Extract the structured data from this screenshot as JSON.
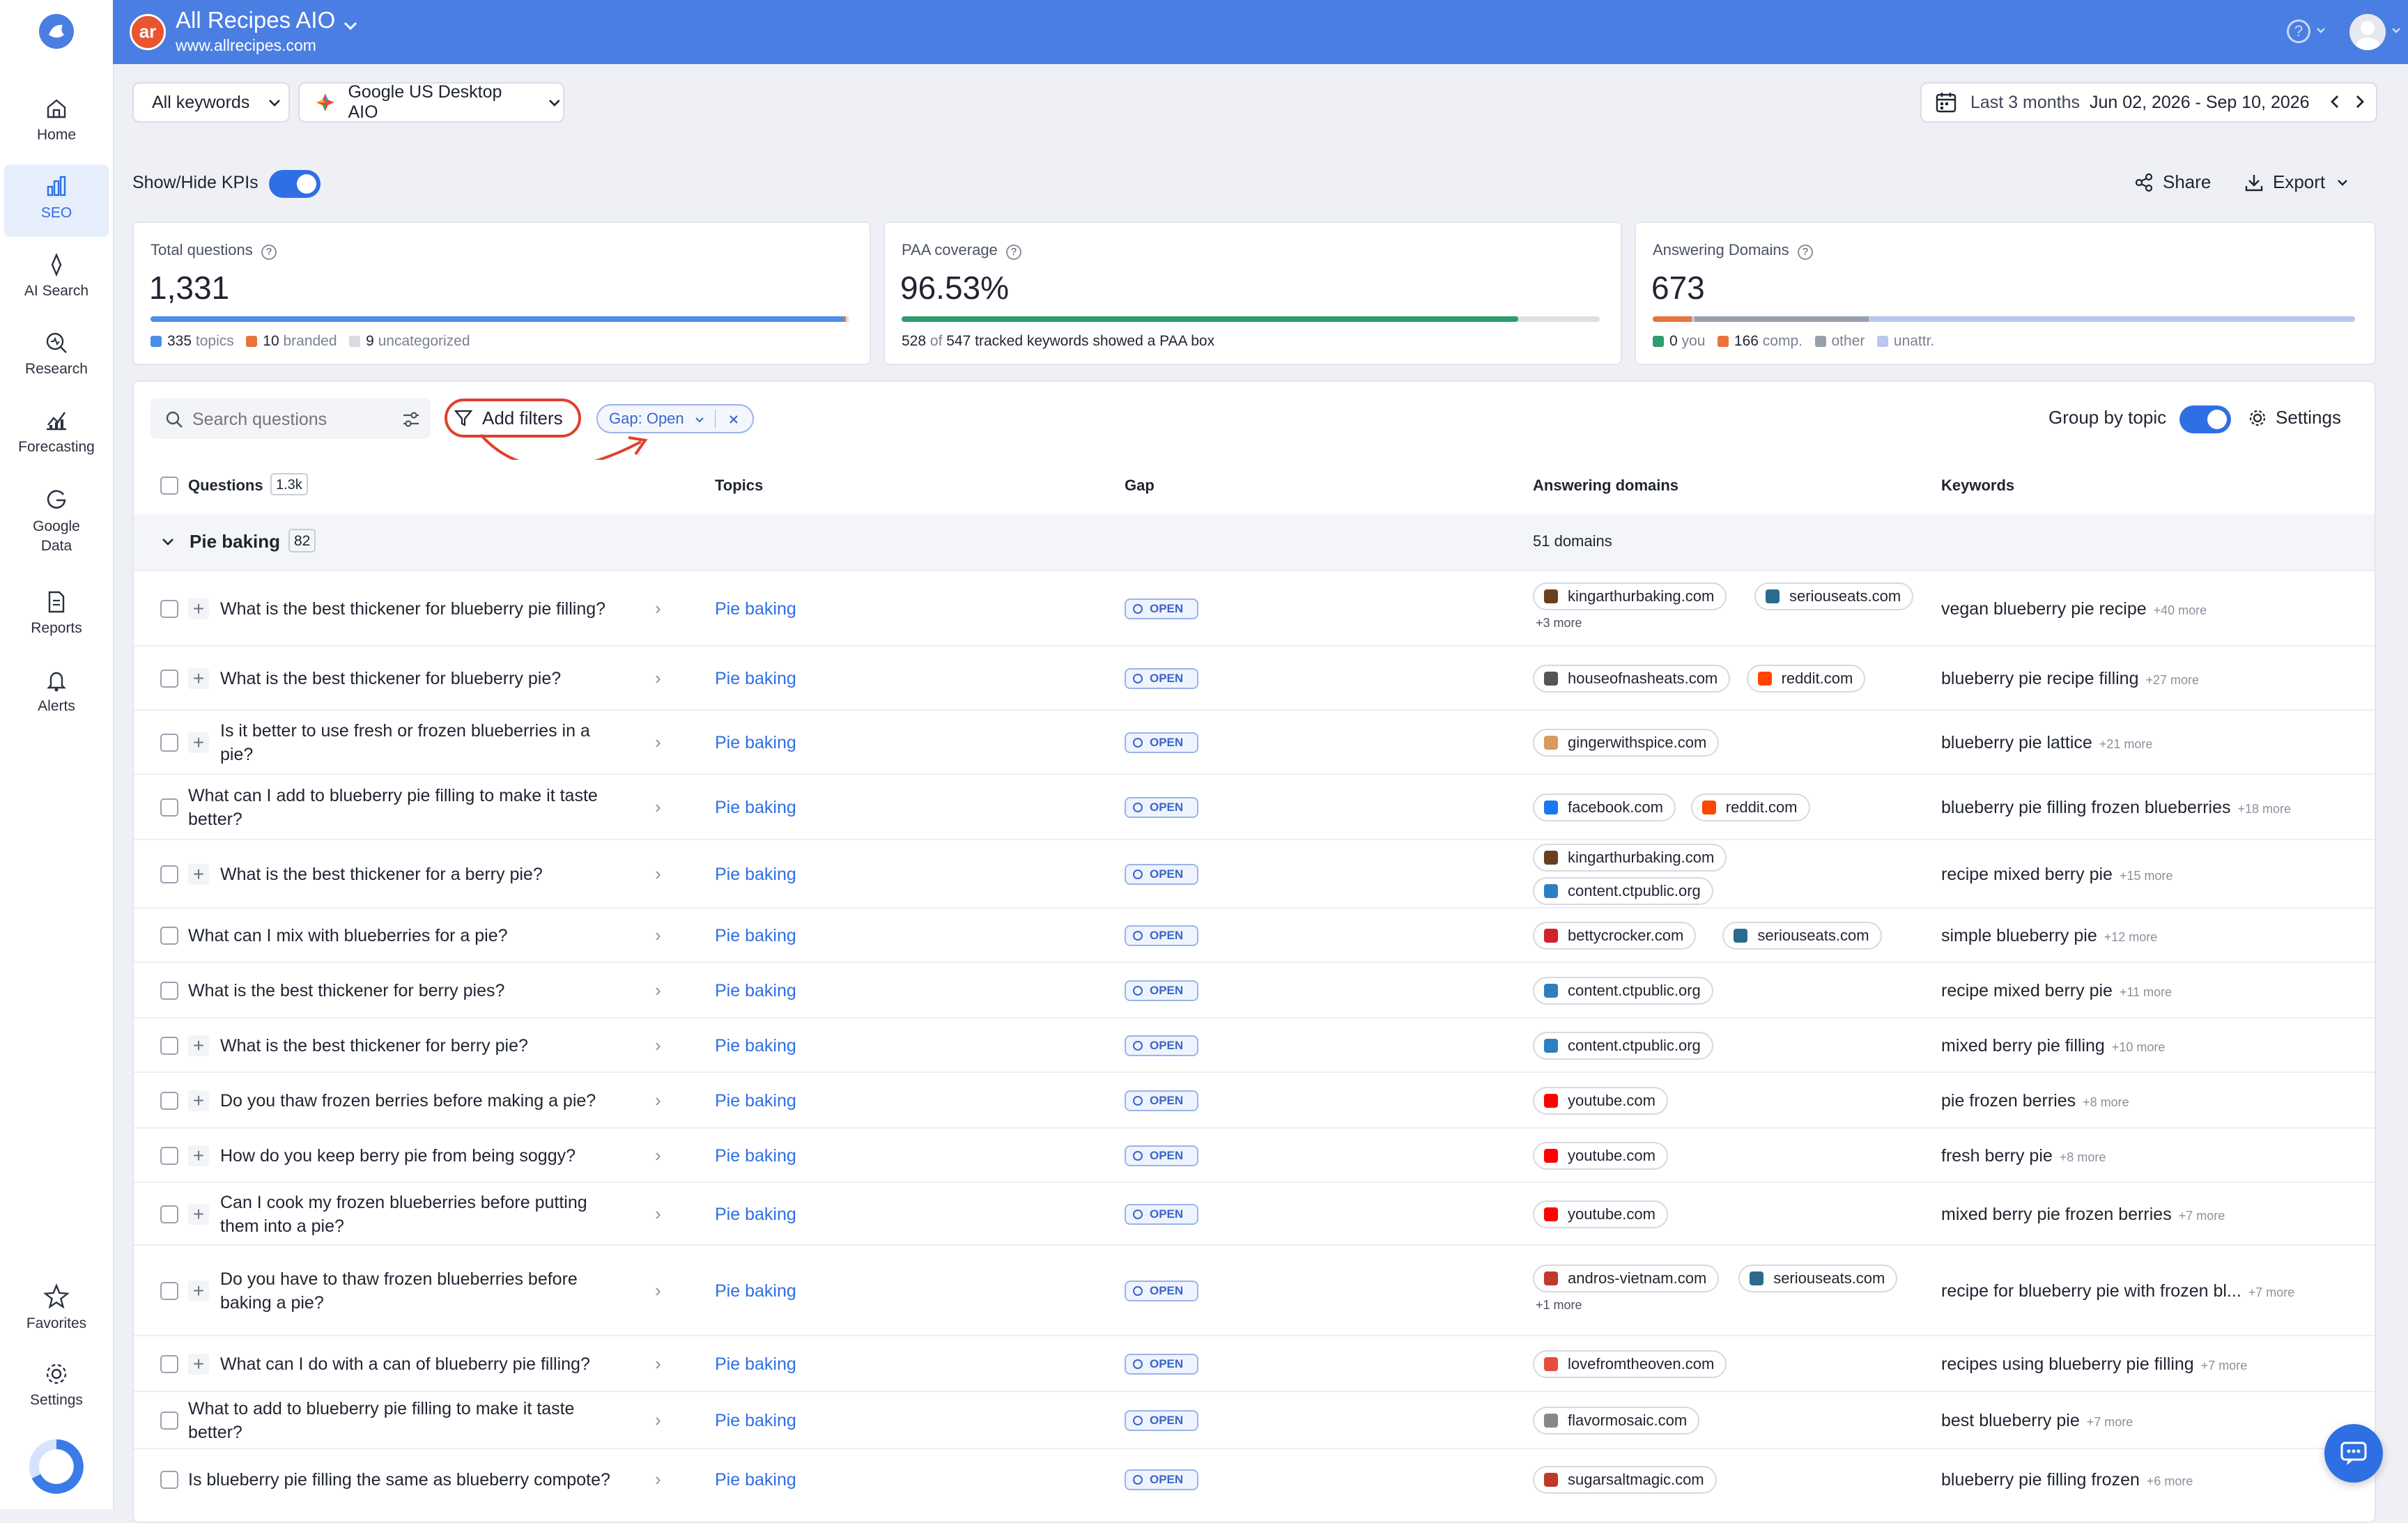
{
  "app": {
    "title": "All Recipes AIO",
    "url": "www.allrecipes.com",
    "logo_text": "ar"
  },
  "nav": [
    {
      "label": "Home",
      "icon": "home-icon"
    },
    {
      "label": "SEO",
      "icon": "bar-chart-icon",
      "active": true
    },
    {
      "label": "AI Search",
      "icon": "sparkle-icon"
    },
    {
      "label": "Research",
      "icon": "magnifier-icon"
    },
    {
      "label": "Forecasting",
      "icon": "chart-line-icon"
    },
    {
      "label": "Google Data",
      "icon": "google-icon"
    },
    {
      "label": "Reports",
      "icon": "report-icon"
    },
    {
      "label": "Alerts",
      "icon": "bell-icon"
    },
    {
      "label": "Favorites",
      "icon": "star-icon"
    },
    {
      "label": "Settings",
      "icon": "gear-icon"
    }
  ],
  "filters": {
    "keywords": "All keywords",
    "engine": "Google US Desktop AIO",
    "period": "Last 3 months",
    "range": "Jun 02, 2026 - Sep 10, 2026"
  },
  "toolbar": {
    "kpi_toggle": "Show/Hide KPIs",
    "share": "Share",
    "export": "Export"
  },
  "kpis": {
    "total": {
      "label": "Total questions",
      "value": "1,331",
      "topics_n": "335",
      "topics": "topics",
      "branded_n": "10",
      "branded": "branded",
      "uncat_n": "9",
      "uncat": "uncategorized"
    },
    "paa": {
      "label": "PAA coverage",
      "value": "96.53%",
      "covered": "528",
      "of": "of",
      "tracked": "547",
      "rest": "tracked keywords showed a PAA box",
      "fill_fraction": 0.9653
    },
    "domains": {
      "label": "Answering Domains",
      "value": "673",
      "you_n": "0",
      "you": "you",
      "comp_n": "166",
      "comp": "comp.",
      "other": "other",
      "unattr": "unattr."
    }
  },
  "table_tools": {
    "search_placeholder": "Search questions",
    "add_filters": "Add filters",
    "filter_chip_key": "Gap:",
    "filter_chip_value": "Open",
    "group_by": "Group by topic",
    "settings": "Settings"
  },
  "columns": {
    "questions": "Questions",
    "questions_count": "1.3k",
    "topics": "Topics",
    "gap": "Gap",
    "domains": "Answering domains",
    "keywords": "Keywords"
  },
  "group": {
    "name": "Pie baking",
    "count": "82",
    "domains": "51 domains"
  },
  "rows": [
    {
      "q": "What is the best thickener for blueberry pie filling?",
      "plus": true,
      "topic": "Pie baking",
      "gap": "OPEN",
      "domains": [
        "kingarthurbaking.com",
        "seriouseats.com"
      ],
      "domains_more": "+3 more",
      "kw": "vegan blueberry pie recipe",
      "kw_more": "+40 more"
    },
    {
      "q": "What is the best thickener for blueberry pie?",
      "plus": true,
      "topic": "Pie baking",
      "gap": "OPEN",
      "domains": [
        "houseofnasheats.com",
        "reddit.com"
      ],
      "domains_more": "",
      "kw": "blueberry pie recipe filling",
      "kw_more": "+27 more"
    },
    {
      "q": "Is it better to use fresh or frozen blueberries in a",
      "q2": "pie?",
      "plus": true,
      "topic": "Pie baking",
      "gap": "OPEN",
      "domains": [
        "gingerwithspice.com"
      ],
      "domains_more": "",
      "kw": "blueberry pie lattice",
      "kw_more": "+21 more"
    },
    {
      "q": "What can I add to blueberry pie filling to make it taste",
      "q2": "better?",
      "plus": false,
      "topic": "Pie baking",
      "gap": "OPEN",
      "domains": [
        "facebook.com",
        "reddit.com"
      ],
      "domains_more": "",
      "kw": "blueberry pie filling frozen blueberries",
      "kw_more": "+18 more"
    },
    {
      "q": "What is the best thickener for a berry pie?",
      "plus": true,
      "topic": "Pie baking",
      "gap": "OPEN",
      "domains": [
        "kingarthurbaking.com",
        "content.ctpublic.org"
      ],
      "domains_more": "",
      "kw": "recipe mixed berry pie",
      "kw_more": "+15 more"
    },
    {
      "q": "What can I mix with blueberries for a pie?",
      "plus": false,
      "topic": "Pie baking",
      "gap": "OPEN",
      "domains": [
        "bettycrocker.com",
        "seriouseats.com"
      ],
      "domains_more": "",
      "kw": "simple blueberry pie",
      "kw_more": "+12 more"
    },
    {
      "q": "What is the best thickener for berry pies?",
      "plus": false,
      "topic": "Pie baking",
      "gap": "OPEN",
      "domains": [
        "content.ctpublic.org"
      ],
      "domains_more": "",
      "kw": "recipe mixed berry pie",
      "kw_more": "+11 more"
    },
    {
      "q": "What is the best thickener for berry pie?",
      "plus": true,
      "topic": "Pie baking",
      "gap": "OPEN",
      "domains": [
        "content.ctpublic.org"
      ],
      "domains_more": "",
      "kw": "mixed berry pie filling",
      "kw_more": "+10 more"
    },
    {
      "q": "Do you thaw frozen berries before making a pie?",
      "plus": true,
      "topic": "Pie baking",
      "gap": "OPEN",
      "domains": [
        "youtube.com"
      ],
      "domains_more": "",
      "kw": "pie frozen berries",
      "kw_more": "+8 more"
    },
    {
      "q": "How do you keep berry pie from being soggy?",
      "plus": true,
      "topic": "Pie baking",
      "gap": "OPEN",
      "domains": [
        "youtube.com"
      ],
      "domains_more": "",
      "kw": "fresh berry pie",
      "kw_more": "+8 more"
    },
    {
      "q": "Can I cook my frozen blueberries before putting",
      "q2": "them into a pie?",
      "plus": true,
      "topic": "Pie baking",
      "gap": "OPEN",
      "domains": [
        "youtube.com"
      ],
      "domains_more": "",
      "kw": "mixed berry pie frozen berries",
      "kw_more": "+7 more"
    },
    {
      "q": "Do you have to thaw frozen blueberries before",
      "q2": "baking a pie?",
      "plus": true,
      "topic": "Pie baking",
      "gap": "OPEN",
      "domains": [
        "andros-vietnam.com",
        "seriouseats.com"
      ],
      "domains_more": "+1 more",
      "kw": "recipe for blueberry pie with frozen bl...",
      "kw_more": "+7 more"
    },
    {
      "q": "What can I do with a can of blueberry pie filling?",
      "plus": true,
      "topic": "Pie baking",
      "gap": "OPEN",
      "domains": [
        "lovefromtheoven.com"
      ],
      "domains_more": "",
      "kw": "recipes using blueberry pie filling",
      "kw_more": "+7 more"
    },
    {
      "q": "What to add to blueberry pie filling to make it taste",
      "q2": "better?",
      "plus": false,
      "topic": "Pie baking",
      "gap": "OPEN",
      "domains": [
        "flavormosaic.com"
      ],
      "domains_more": "",
      "kw": "best blueberry pie",
      "kw_more": "+7 more"
    },
    {
      "q": "Is blueberry pie filling the same as blueberry compote?",
      "plus": false,
      "topic": "Pie baking",
      "gap": "OPEN",
      "domains": [
        "sugarsaltmagic.com"
      ],
      "domains_more": "",
      "kw": "blueberry pie filling frozen",
      "kw_more": "+6 more"
    }
  ],
  "colors": {
    "brand": "#4a7ee2",
    "accent": "#2f6fe4",
    "annotation": "#e0412b"
  }
}
